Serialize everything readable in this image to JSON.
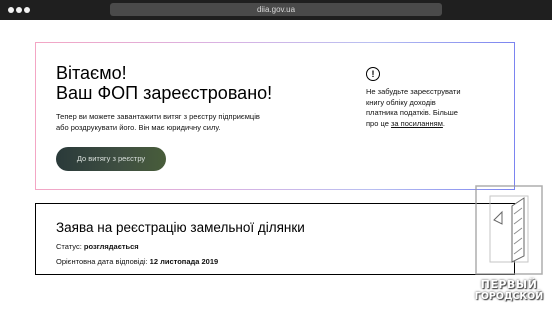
{
  "browser": {
    "url": "diia.gov.ua"
  },
  "main_card": {
    "headline_line1": "Вітаємо!",
    "headline_line2": "Ваш ФОП зареєстровано!",
    "subtext_line1": "Тепер ви можете завантажити витяг з реєстру підприємців",
    "subtext_line2": "або роздрукувати його. Він має юридичну силу.",
    "button_label": "До витягу з реєстру",
    "alert_icon_glyph": "!",
    "notice_line1": "Не забудьте зареєструвати",
    "notice_line2": "книгу обліку доходів",
    "notice_line3": "платника податків. Більше",
    "notice_line4_prefix": "про це ",
    "notice_link": "за посиланням",
    "notice_line4_suffix": "."
  },
  "application_card": {
    "title": "Заява на реєстрацію замельної ділянки",
    "status_label": "Статус: ",
    "status_value": "розглядається",
    "date_label": "Орієнтовна дата відповіді: ",
    "date_value": "12 листопада 2019"
  },
  "watermark": {
    "line1": "ПЕРВЫЙ",
    "line2": "ГОРОДСКОЙ"
  }
}
